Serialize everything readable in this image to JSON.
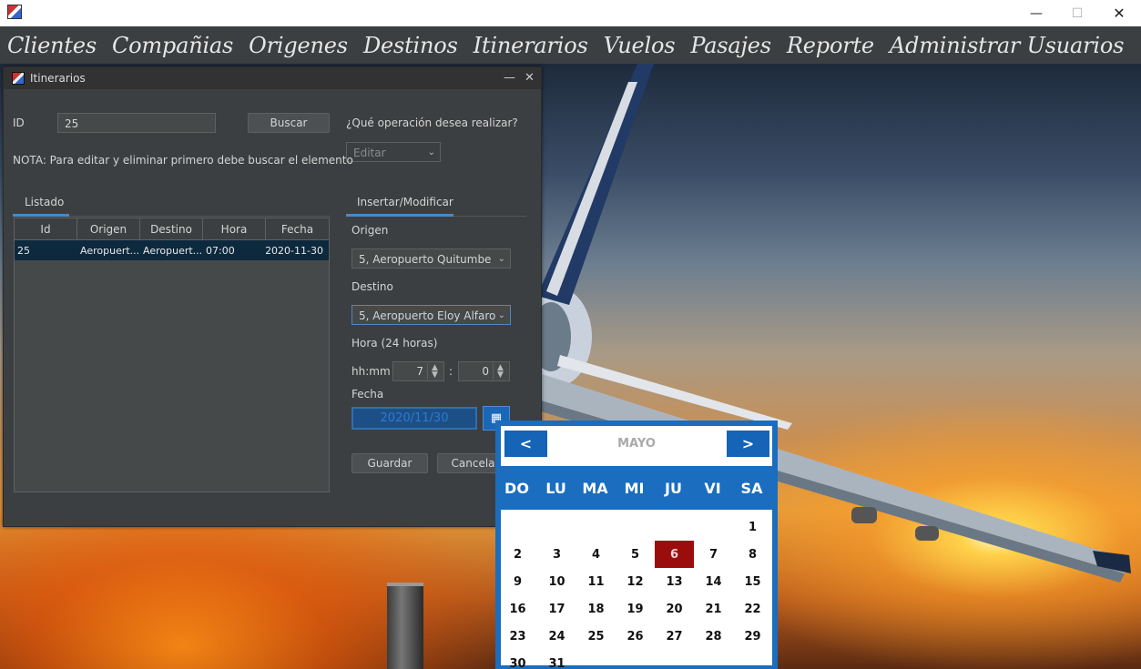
{
  "window": {
    "controls": {
      "minimize": "—",
      "maximize": "☐",
      "close": "✕"
    }
  },
  "menu": [
    "Clientes",
    "Compañias",
    "Origenes",
    "Destinos",
    "Itinerarios",
    "Vuelos",
    "Pasajes",
    "Reporte",
    "Administrar Usuarios"
  ],
  "frame": {
    "title": "Itinerarios",
    "id_label": "ID",
    "id_value": "25",
    "search_button": "Buscar",
    "operation_label": "¿Qué operación desea realizar?",
    "operation_value": "Editar",
    "note": "NOTA: Para editar y eliminar primero debe buscar el elemento",
    "tab_list": "Listado",
    "tab_edit": "Insertar/Modificar",
    "table": {
      "columns": [
        "Id",
        "Origen",
        "Destino",
        "Hora",
        "Fecha"
      ],
      "rows": [
        [
          "25",
          "Aeropuert...",
          "Aeropuert...",
          "07:00",
          "2020-11-30"
        ]
      ]
    },
    "origin_label": "Origen",
    "origin_value": "5, Aeropuerto Quitumbe",
    "dest_label": "Destino",
    "dest_value": "5, Aeropuerto Eloy Alfaro",
    "time_label": "Hora (24 horas)",
    "time_format": "hh:mm",
    "hour": "7",
    "minute": "0",
    "colon": ":",
    "date_label": "Fecha",
    "date_value": "2020/11/30",
    "save_button": "Guardar",
    "cancel_button": "Cancelar"
  },
  "calendar": {
    "prev": "<",
    "next": ">",
    "month": "MAYO",
    "weekdays": [
      "DO",
      "LU",
      "MA",
      "MI",
      "JU",
      "VI",
      "SA"
    ],
    "days": [
      "1",
      "2",
      "3",
      "4",
      "5",
      "6",
      "7",
      "8",
      "9",
      "10",
      "11",
      "12",
      "13",
      "14",
      "15",
      "16",
      "17",
      "18",
      "19",
      "20",
      "21",
      "22",
      "23",
      "24",
      "25",
      "26",
      "27",
      "28",
      "29",
      "30",
      "31"
    ],
    "first_weekday": 6,
    "selected": 6,
    "selected_color": "#9b0d0d",
    "accent": "#1a6dbf"
  }
}
